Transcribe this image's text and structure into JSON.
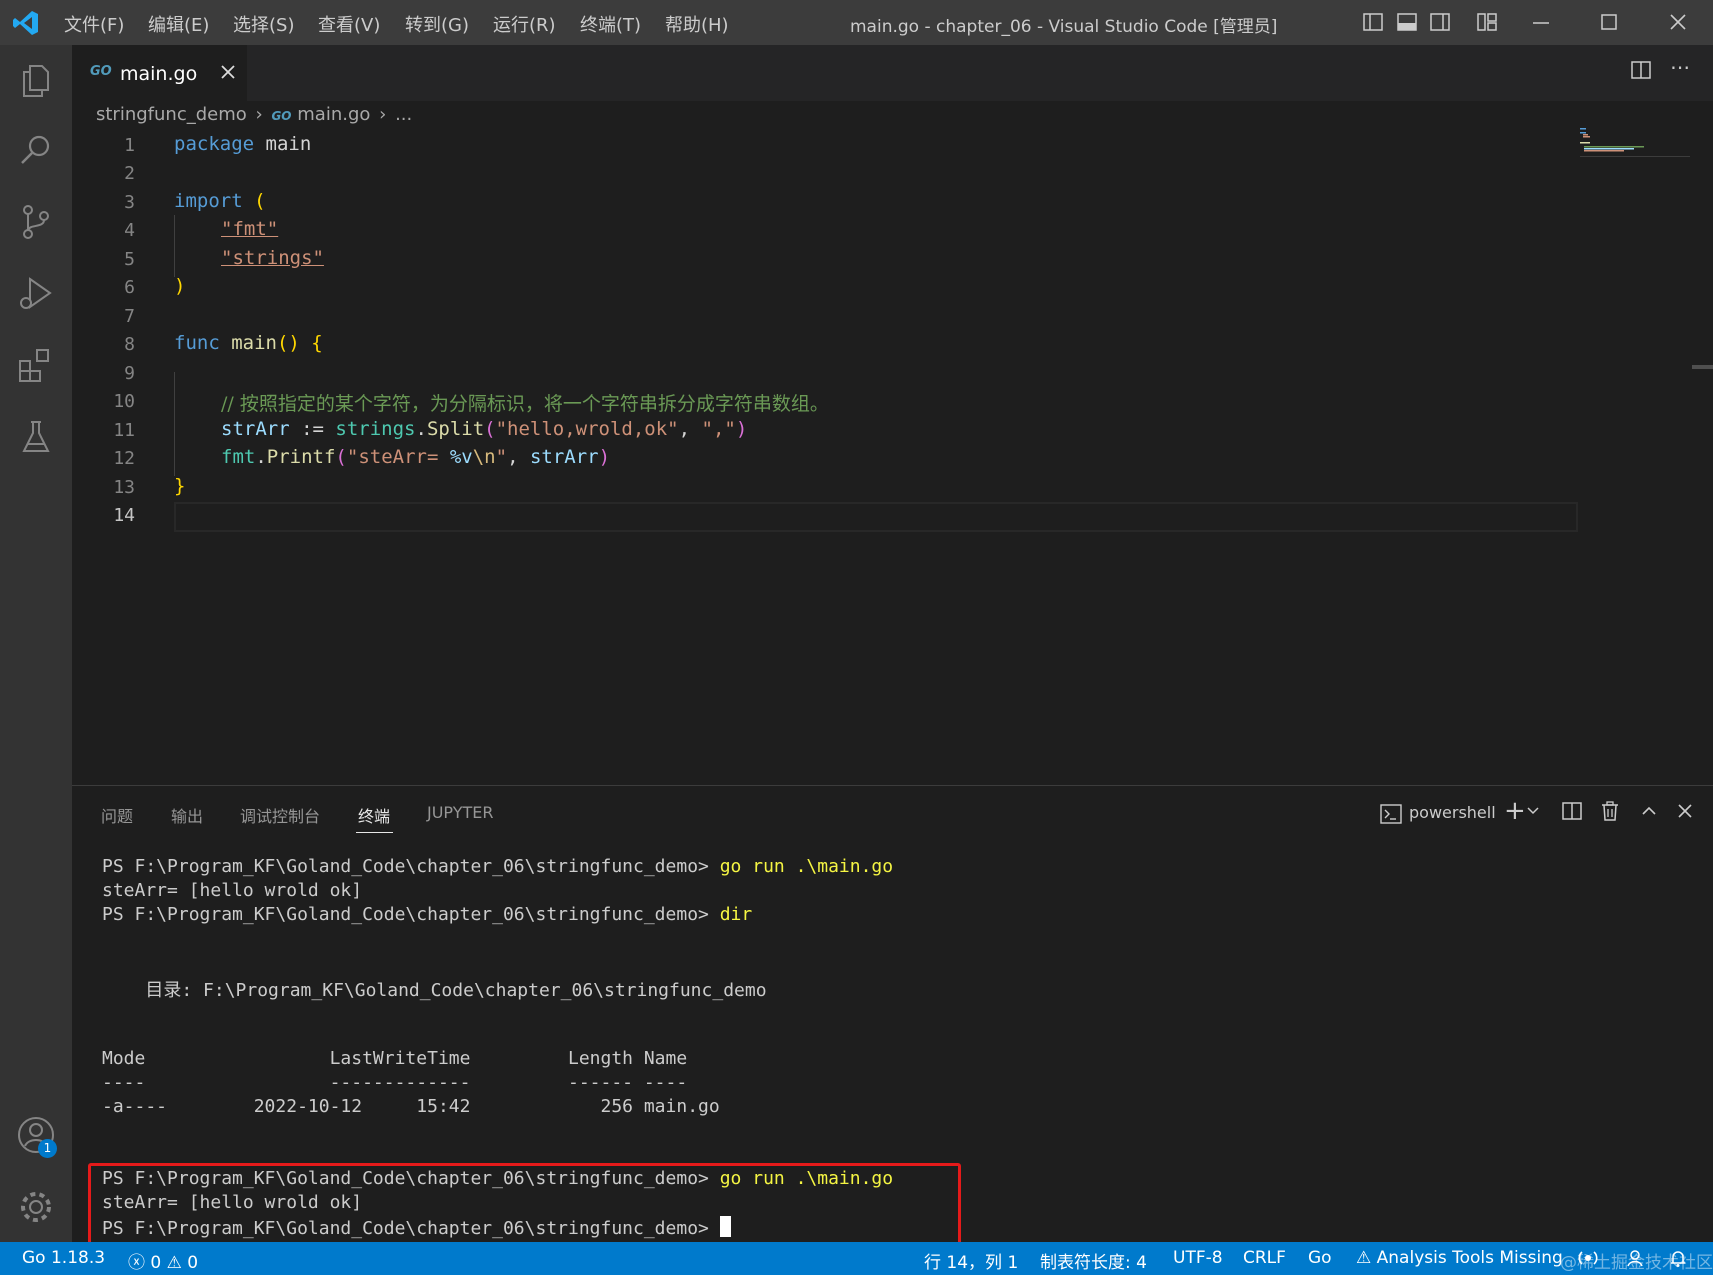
{
  "window": {
    "title": "main.go - chapter_06 - Visual Studio Code [管理员]",
    "menu": [
      "文件(F)",
      "编辑(E)",
      "选择(S)",
      "查看(V)",
      "转到(G)",
      "运行(R)",
      "终端(T)",
      "帮助(H)"
    ]
  },
  "activity_bar": {
    "items": [
      "explorer-icon",
      "search-icon",
      "source-control-icon",
      "run-debug-icon",
      "extensions-icon",
      "testing-icon"
    ],
    "bottom": [
      "accounts-icon",
      "settings-gear-icon"
    ],
    "accounts_badge": "1"
  },
  "tabs": [
    {
      "label": "main.go",
      "icon": "GO"
    }
  ],
  "breadcrumb": {
    "folder": "stringfunc_demo",
    "file_icon": "GO",
    "file": "main.go",
    "more": "..."
  },
  "editor": {
    "line_numbers": [
      "1",
      "2",
      "3",
      "4",
      "5",
      "6",
      "7",
      "8",
      "9",
      "10",
      "11",
      "12",
      "13",
      "14"
    ],
    "current_line": "14",
    "code": {
      "l1_kw": "package",
      "l1_name": " main",
      "l3_kw": "import",
      "l3_paren": " (",
      "l4_str": "\"fmt\"",
      "l5_str": "\"strings\"",
      "l6_paren": ")",
      "l8_kw": "func",
      "l8_fn": " main",
      "l8_parens": "()",
      "l8_brace": " {",
      "l10_comment": "// 按照指定的某个字符，为分隔标识，将一个字符串拆分成字符串数组。",
      "l11_var": "strArr",
      "l11_op": " := ",
      "l11_pkg": "strings",
      "l11_dot": ".",
      "l11_fn": "Split",
      "l11_p1": "(",
      "l11_s1": "\"hello,wrold,ok\"",
      "l11_comma": ", ",
      "l11_s2": "\",\"",
      "l11_p2": ")",
      "l12_pkg": "fmt",
      "l12_dot": ".",
      "l12_fn": "Printf",
      "l12_p1": "(",
      "l12_s1a": "\"steArr= ",
      "l12_esc1": "%v",
      "l12_esc2": "\\n",
      "l12_s1b": "\"",
      "l12_comma": ", ",
      "l12_var": "strArr",
      "l12_p2": ")",
      "l13_brace": "}"
    }
  },
  "panel": {
    "tabs": [
      "问题",
      "输出",
      "调试控制台",
      "终端",
      "JUPYTER"
    ],
    "active_tab": "终端",
    "shell_label": "powershell",
    "terminal": {
      "prompt": "PS F:\\Program_KF\\Goland_Code\\chapter_06\\stringfunc_demo> ",
      "cmd_run": "go run .\\main.go",
      "output": "steArr= [hello wrold ok]",
      "cmd_dir": "dir",
      "dir_header": "    目录: F:\\Program_KF\\Goland_Code\\chapter_06\\stringfunc_demo",
      "table_header": "Mode                 LastWriteTime         Length Name",
      "table_rule": "----                 -------------         ------ ----",
      "table_row": "-a----        2022-10-12     15:42            256 main.go"
    }
  },
  "status_bar": {
    "go_version": "Go 1.18.3",
    "problems": "0",
    "warnings": "0",
    "position": "行 14，列 1",
    "indent": "制表符长度: 4",
    "encoding": "UTF-8",
    "eol": "CRLF",
    "language": "Go",
    "analysis": "Analysis Tools Missing"
  },
  "watermark": "@稀土掘金技术社区",
  "colors": {
    "accent": "#007acc",
    "highlight_box": "#e51a1a"
  }
}
